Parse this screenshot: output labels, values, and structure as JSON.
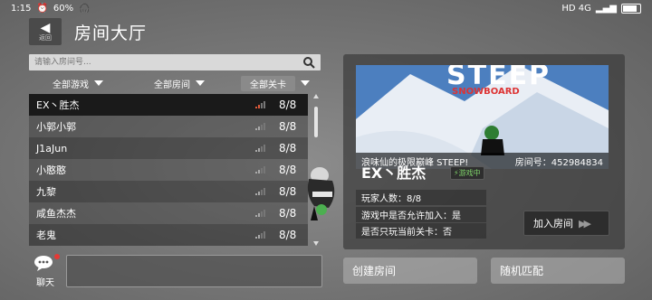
{
  "status_bar": {
    "time": "1:15",
    "indicators_left": "60%",
    "network_right": "HD 4G"
  },
  "header": {
    "back_label": "返回",
    "title": "房间大厅"
  },
  "search": {
    "placeholder": "请输入房间号..."
  },
  "filters": [
    {
      "label": "全部游戏"
    },
    {
      "label": "全部房间"
    },
    {
      "label": "全部关卡"
    }
  ],
  "rooms": [
    {
      "name": "EX丶胜杰",
      "count": "8/8"
    },
    {
      "name": "小郭小郭",
      "count": "8/8"
    },
    {
      "name": "J1aJun",
      "count": "8/8"
    },
    {
      "name": "小憨憨",
      "count": "8/8"
    },
    {
      "name": "九黎",
      "count": "8/8"
    },
    {
      "name": "咸鱼杰杰",
      "count": "8/8"
    },
    {
      "name": "老鬼",
      "count": "8/8"
    }
  ],
  "chat": {
    "label": "聊天"
  },
  "detail": {
    "preview_logo": "STEEP",
    "preview_sub": "SNOWBOARD",
    "caption_left": "浪味仙的极限巅峰 STEEP!",
    "caption_right": "房间号：452984834",
    "room_name": "EX丶胜杰",
    "status_badge": "游戏中",
    "players": "玩家人数：8/8",
    "allow_join": "游戏中是否允许加入：是",
    "current_level_only": "是否只玩当前关卡：否",
    "join_label": "加入房间"
  },
  "buttons": {
    "create": "创建房间",
    "match": "随机匹配"
  },
  "colors": {
    "accent_green": "#7fd36a",
    "selected_row": "#1a1a1a",
    "notification_red": "#e53935"
  }
}
